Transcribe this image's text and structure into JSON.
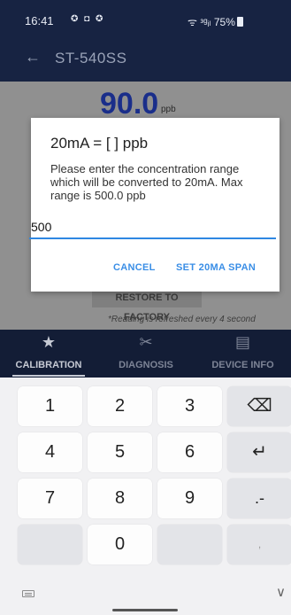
{
  "status_bar": {
    "time": "16:41",
    "notification_icons": "✪ ◘ ✪",
    "network": "ᯤ ᵌᵍᵢₗ",
    "battery": "75%"
  },
  "app_bar": {
    "back_icon": "←",
    "title": "ST-540SS"
  },
  "content": {
    "reading_value": "90.0",
    "reading_unit": "ppb",
    "restore_label": "RESTORE TO FACTORY",
    "refresh_note": "*Reading is refreshed every 4 second"
  },
  "bottom_nav": {
    "items": [
      {
        "label": "CALIBRATION",
        "icon": "★",
        "active": true
      },
      {
        "label": "DIAGNOSIS",
        "icon": "✂",
        "active": false
      },
      {
        "label": "DEVICE INFO",
        "icon": "▤",
        "active": false
      }
    ]
  },
  "dialog": {
    "title": "20mA = [ ] ppb",
    "message": "Please enter the concentration range which will be converted to 20mA. Max range is 500.0 ppb",
    "input_value": "500",
    "cancel_label": "CANCEL",
    "confirm_label": "SET 20MA SPAN"
  },
  "keyboard": {
    "keys": [
      "1",
      "2",
      "3",
      "⌫",
      "4",
      "5",
      "6",
      "↵",
      "7",
      "8",
      "9",
      ".-",
      "",
      "0",
      "",
      ","
    ]
  },
  "colors": {
    "app_bar": "#172342",
    "accent": "#3a8ee6",
    "reading": "#1a2e8a"
  }
}
